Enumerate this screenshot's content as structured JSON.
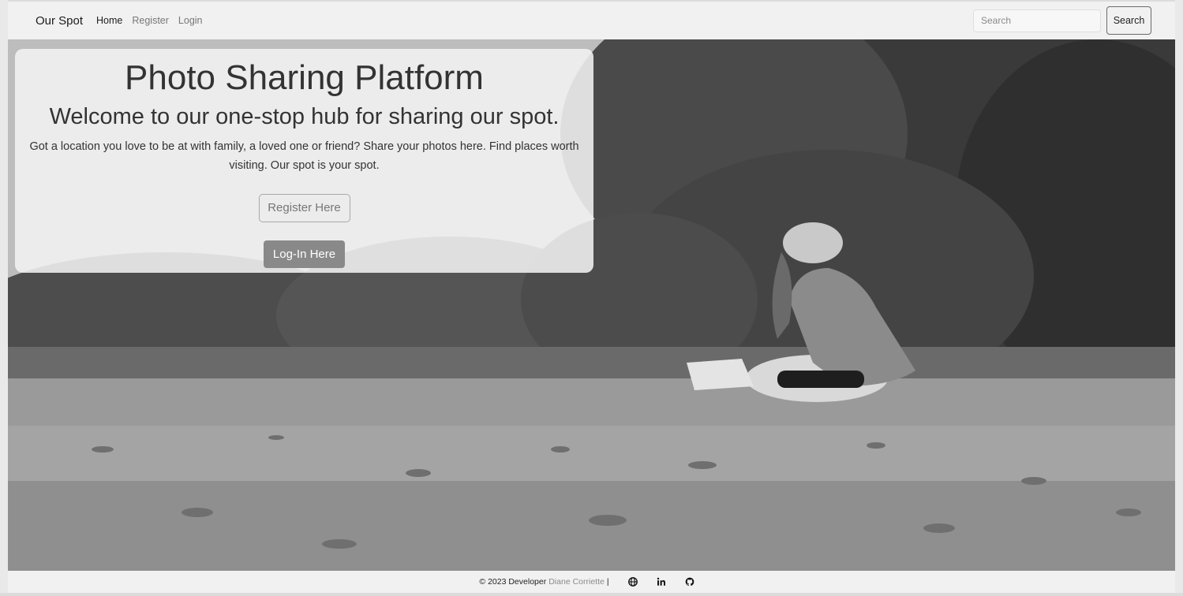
{
  "navbar": {
    "brand": "Our Spot",
    "links": [
      {
        "label": "Home",
        "active": true
      },
      {
        "label": "Register",
        "active": false
      },
      {
        "label": "Login",
        "active": false
      }
    ],
    "search_placeholder": "Search",
    "search_button": "Search"
  },
  "hero": {
    "title": "Photo Sharing Platform",
    "subtitle": "Welcome to our one-stop hub for sharing our spot.",
    "text": "Got a location you love to be at with family, a loved one or friend? Share your photos here. Find places worth visiting. Our spot is your spot.",
    "register_button": "Register Here",
    "login_button": "Log-In Here"
  },
  "footer": {
    "copyright": "© 2023 Developer",
    "developer": "Diane Corriette",
    "separator": "|",
    "icons": [
      "globe-icon",
      "linkedin-icon",
      "github-icon"
    ]
  },
  "colors": {
    "navbar_bg": "#f1f1f1",
    "card_bg": "#f3f3f3",
    "login_button_bg": "#898989",
    "muted_text": "#8a8a8a"
  }
}
